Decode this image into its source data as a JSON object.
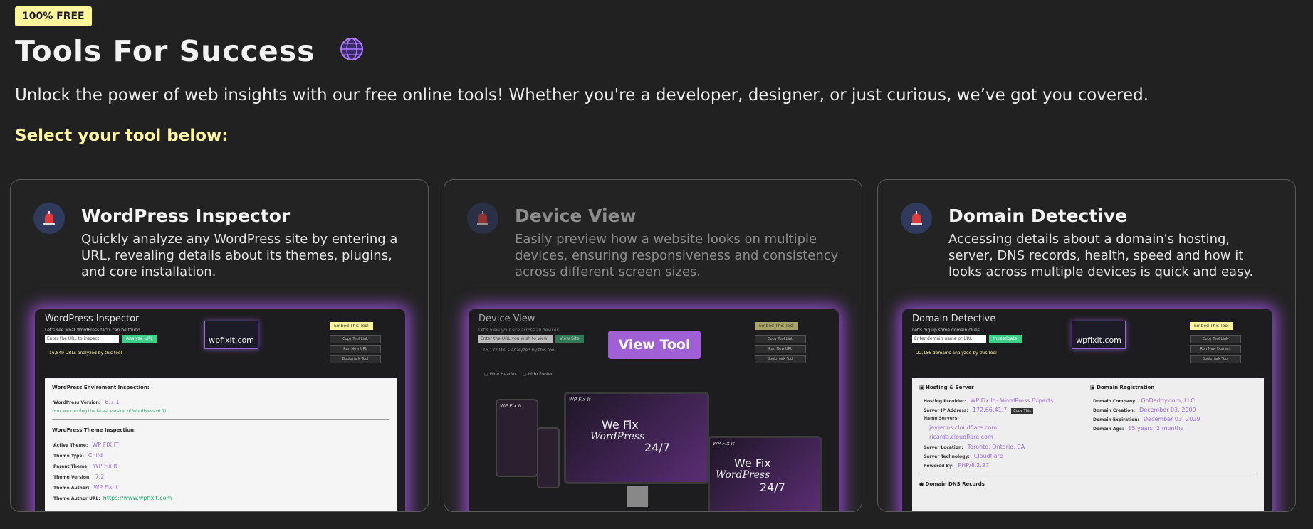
{
  "badge": "100% FREE",
  "title": "Tools For Success",
  "subtitle": "Unlock the power of web insights with our free online tools! Whether you're a developer, designer, or just curious, we’ve got you covered.",
  "select_label": "Select your tool below:",
  "accent": "#fff59a",
  "glow": "#b45aff",
  "cards": [
    {
      "title": "WordPress Inspector",
      "desc": "Quickly analyze any WordPress site by entering a URL, revealing details about its themes, plugins, and core installation.",
      "shot": {
        "title": "WordPress Inspector",
        "prompt": "Let's see what WordPress facts can be found...",
        "input_placeholder": "Enter the URL to inspect",
        "go": "Analyze URL",
        "count": "16,849 URLs analyzed by this tool",
        "logo": "wpfixit.com",
        "embed": "Embed This Tool",
        "side": [
          "Copy Tool Link",
          "Run New URL",
          "Bookmark Tool"
        ],
        "sections": {
          "core": "WordPress Enviroment Inspection:",
          "version_label": "WordPress Version:",
          "version": "6.7.1",
          "latest": "You are running the latest version of WordPress (6.7)",
          "theme": "WordPress Theme Inspection:",
          "rows": [
            {
              "label": "Active Theme:",
              "value": "WP FIX IT"
            },
            {
              "label": "Theme Type:",
              "value": "Child"
            },
            {
              "label": "Parent Theme:",
              "value": "WP Fix It"
            },
            {
              "label": "Theme Version:",
              "value": "7.2"
            },
            {
              "label": "Theme Author:",
              "value": "WP Fix It"
            }
          ],
          "author_url_label": "Theme Author URL:",
          "author_url": "https://www.wpfixit.com"
        }
      }
    },
    {
      "title": "Device View",
      "desc": "Easily preview how a website looks on multiple devices, ensuring responsiveness and consistency across different screen sizes.",
      "shot": {
        "title": "Device View",
        "prompt": "Let's view your site across all devices...",
        "input_placeholder": "Enter the URL you wish to view",
        "go": "View Site",
        "count": "16,122 URLs analyzed by this tool",
        "embed": "Embed This Tool",
        "side": [
          "Copy Tool Link",
          "Run New URL",
          "Bookmark Tool"
        ],
        "opts": [
          "Hide Header",
          "Hide Footer"
        ],
        "overlay": "View Tool",
        "hero_line1": "We Fix",
        "hero_line2": "WordPress",
        "hero_line3": "24/7",
        "brand": "WP Fix It"
      }
    },
    {
      "title": "Domain Detective",
      "desc": "Accessing details about a domain's hosting, server, DNS records, health, speed and how it looks across multiple devices is quick and easy.",
      "shot": {
        "title": "Domain Detective",
        "prompt": "Let's dig up some domain clues...",
        "input_placeholder": "Enter domain name or URL",
        "go": "Investigate",
        "count": "22,156 domains analyzed by this tool",
        "logo": "wpfixit.com",
        "embed": "Embed This Tool",
        "side": [
          "Copy Tool Link",
          "Run New Domain",
          "Bookmark Tool"
        ],
        "hosting_head": "Hosting & Server",
        "hosting": [
          {
            "label": "Hosting Provider:",
            "value": "WP Fix It - WordPress Experts"
          },
          {
            "label": "Server IP Address:",
            "value": "172.66.41.7"
          },
          {
            "label": "Name Servers:",
            "value": ""
          },
          {
            "label": "",
            "value": "javier.ns.cloudflare.com"
          },
          {
            "label": "",
            "value": "ricarda.cloudflare.com"
          },
          {
            "label": "Server Location:",
            "value": "Toronto, Ontario, CA"
          },
          {
            "label": "Server Technology:",
            "value": "Cloudflare"
          },
          {
            "label": "Powered By:",
            "value": "PHP/8.2.27"
          }
        ],
        "copy_ip": "Copy This",
        "reg_head": "Domain Registration",
        "registration": [
          {
            "label": "Domain Company:",
            "value": "GoDaddy.com, LLC"
          },
          {
            "label": "Domain Creation:",
            "value": "December 03, 2009"
          },
          {
            "label": "Domain Expiration:",
            "value": "December 03, 2029"
          },
          {
            "label": "Domain Age:",
            "value": "15 years, 2 months"
          }
        ],
        "dns_head": "Domain DNS Records"
      }
    }
  ]
}
